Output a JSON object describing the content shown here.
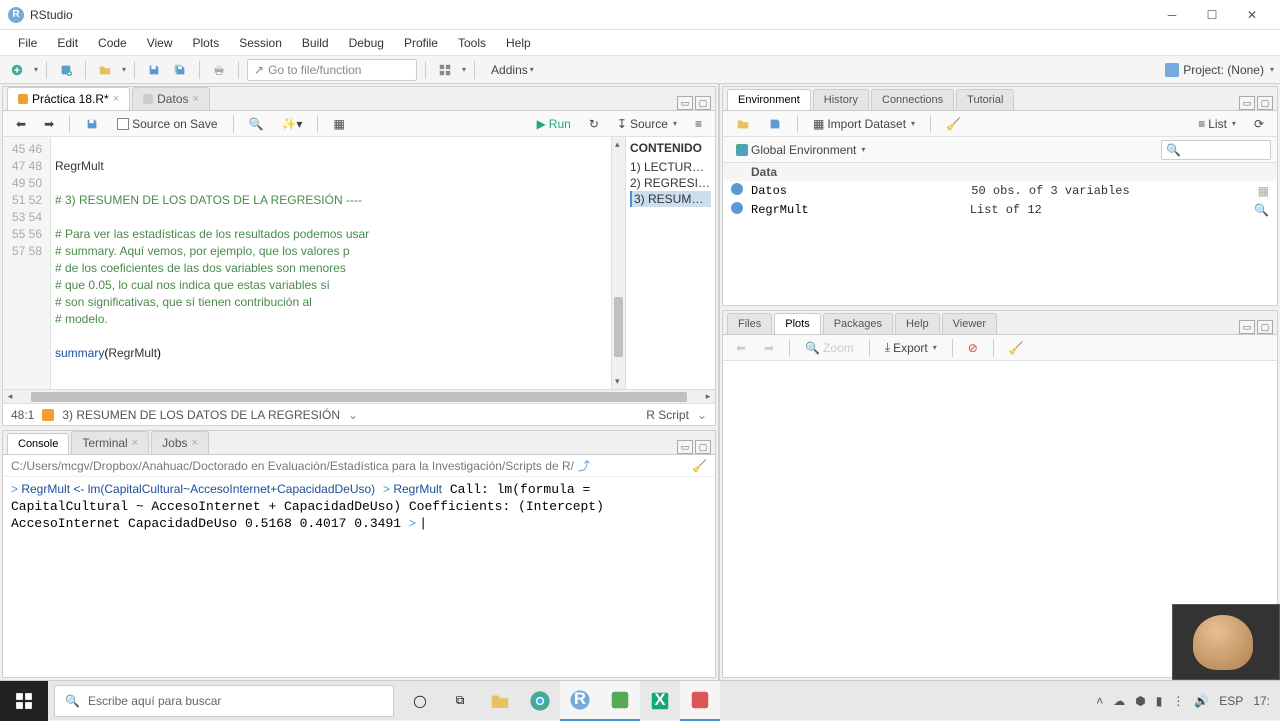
{
  "window": {
    "title": "RStudio"
  },
  "menubar": [
    "File",
    "Edit",
    "Code",
    "View",
    "Plots",
    "Session",
    "Build",
    "Debug",
    "Profile",
    "Tools",
    "Help"
  ],
  "toolbar": {
    "gotofile_placeholder": "Go to file/function",
    "addins": "Addins",
    "project_label": "Project: (None)"
  },
  "source": {
    "tabs": [
      {
        "label": "Práctica 18.R*",
        "icon": "#f0a030"
      },
      {
        "label": "Datos",
        "icon": "#ccc"
      }
    ],
    "source_on_save": "Source on Save",
    "run": "Run",
    "source_btn": "Source",
    "gutter_start": 45,
    "gutter_end": 58,
    "lines": [
      "",
      "RegrMult",
      "",
      "# 3) RESUMEN DE LOS DATOS DE LA REGRESIÓN ----",
      "",
      "# Para ver las estadísticas de los resultados podemos usar",
      "# summary. Aquí vemos, por ejemplo, que los valores p",
      "# de los coeficientes de las dos variables son menores",
      "# que 0.05, lo cual nos indica que estas variables sí",
      "# son significativas, que sí tienen contribución al",
      "# modelo.",
      "",
      "summary(RegrMult)",
      ""
    ],
    "outline_head": "CONTENIDO",
    "outline": [
      "1) LECTURA…",
      "2) REGRESI…",
      "3) RESUME…"
    ],
    "status_pos": "48:1",
    "status_crumb": "3) RESUMEN DE LOS DATOS DE LA REGRESIÓN",
    "status_lang": "R Script"
  },
  "console": {
    "tabs": [
      "Console",
      "Terminal",
      "Jobs"
    ],
    "path": "C:/Users/mcgv/Dropbox/Anahuac/Doctorado en Evaluación/Estadística para la Investigación/Scripts de R/",
    "lines_html": [
      "<span class='prompt'>&gt; </span><span class='inp'>RegrMult &lt;- lm(CapitalCultural~AccesoInternet+CapacidadDeUso)</span>",
      "<span class='prompt'>&gt; </span><span class='inp'>RegrMult</span>",
      "",
      "Call:",
      "lm(formula = CapitalCultural ~ AccesoInternet + CapacidadDeUso)",
      "",
      "Coefficients:",
      "   (Intercept)  AccesoInternet  CapacidadDeUso  ",
      "        0.5168          0.4017          0.3491  ",
      "",
      "<span class='prompt'>&gt; </span>|"
    ]
  },
  "env": {
    "tabs": [
      "Environment",
      "History",
      "Connections",
      "Tutorial"
    ],
    "import": "Import Dataset",
    "list": "List",
    "scope": "Global Environment",
    "header": "Data",
    "rows": [
      {
        "icon": "blue",
        "name": "Datos",
        "desc": "50 obs. of 3 variables"
      },
      {
        "icon": "blue",
        "name": "RegrMult",
        "desc": "List of 12"
      }
    ]
  },
  "plots": {
    "tabs": [
      "Files",
      "Plots",
      "Packages",
      "Help",
      "Viewer"
    ],
    "zoom": "Zoom",
    "export": "Export"
  },
  "taskbar": {
    "search_placeholder": "Escribe aquí para buscar",
    "lang": "ESP",
    "time": "17:"
  }
}
